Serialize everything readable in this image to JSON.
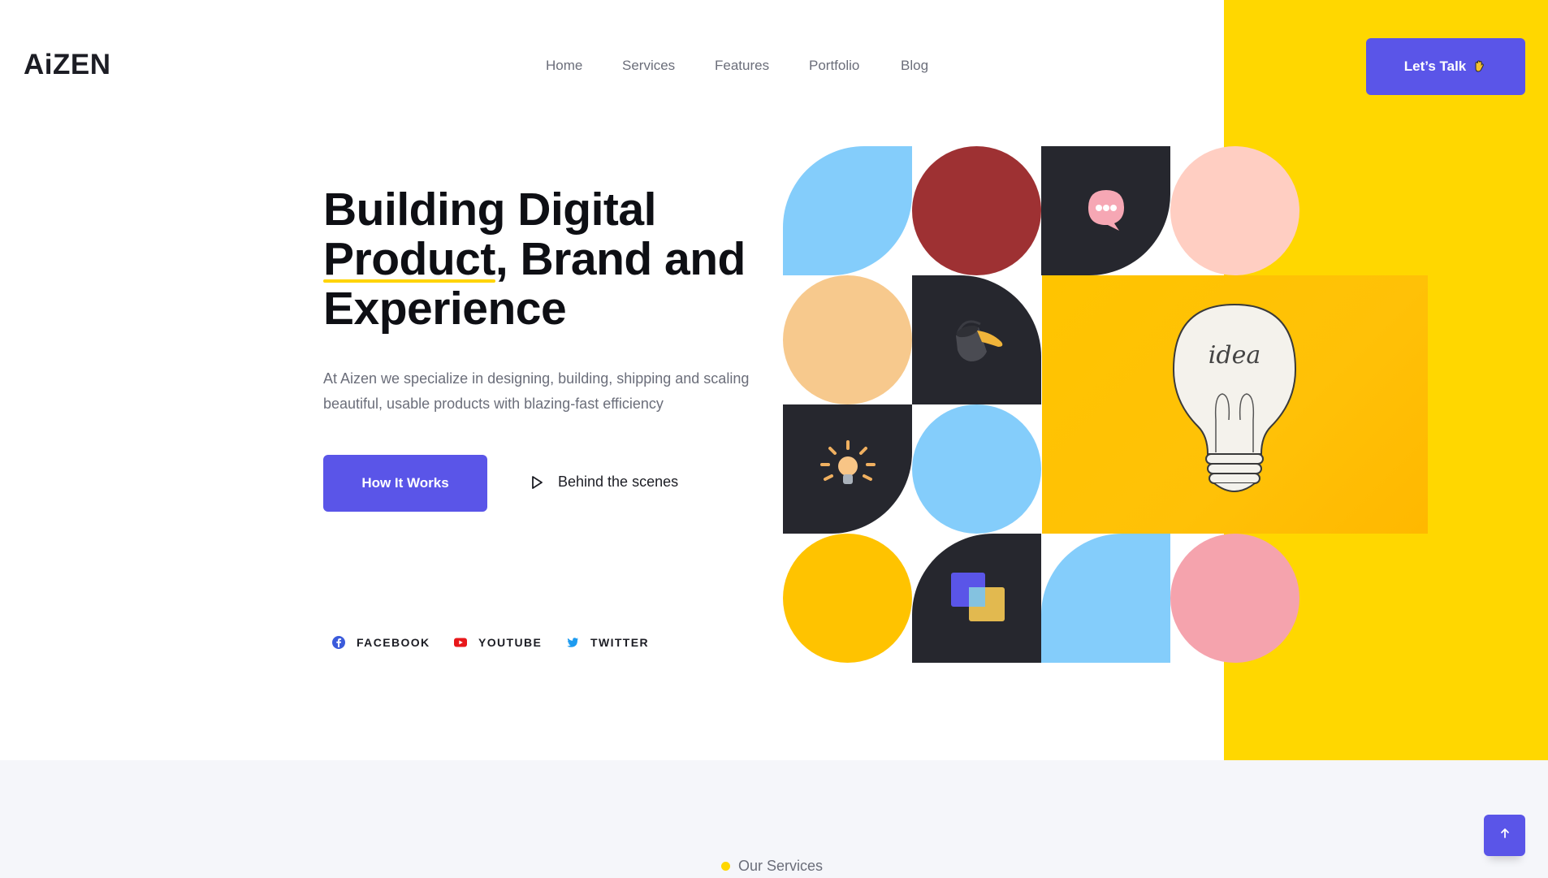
{
  "brand": {
    "logo": "AiZEN"
  },
  "nav": {
    "items": [
      {
        "label": "Home"
      },
      {
        "label": "Services"
      },
      {
        "label": "Features"
      },
      {
        "label": "Portfolio"
      },
      {
        "label": "Blog"
      }
    ]
  },
  "header": {
    "cta_label": "Let’s Talk",
    "cta_icon": "waving-hand-icon"
  },
  "hero": {
    "title_line1": "Building Digital",
    "title_line2_underlined": "Product",
    "title_line2_rest": ", Brand and",
    "title_line3": "Experience",
    "description": "At Aizen we specialize in designing, building, shipping and scaling beautiful, usable products with blazing-fast efficiency",
    "primary_button": "How It Works",
    "secondary_link": "Behind the scenes"
  },
  "social": [
    {
      "label": "FACEBOOK",
      "icon": "facebook-icon",
      "color": "#3b5bdb"
    },
    {
      "label": "YOUTUBE",
      "icon": "youtube-icon",
      "color": "#e8181b"
    },
    {
      "label": "TWITTER",
      "icon": "twitter-icon",
      "color": "#1d9bf0"
    }
  ],
  "illustration": {
    "idea_text": "idea"
  },
  "services_section": {
    "label": "Our Services"
  },
  "colors": {
    "accent": "#5a55e8",
    "yellow": "#ffd700",
    "dark": "#26272e",
    "light_blue": "#84cdfb",
    "maroon": "#9e3133",
    "peach": "#f7c98d",
    "pink": "#ffcec2",
    "rose": "#f5a3ad",
    "gold": "#ffc300"
  }
}
